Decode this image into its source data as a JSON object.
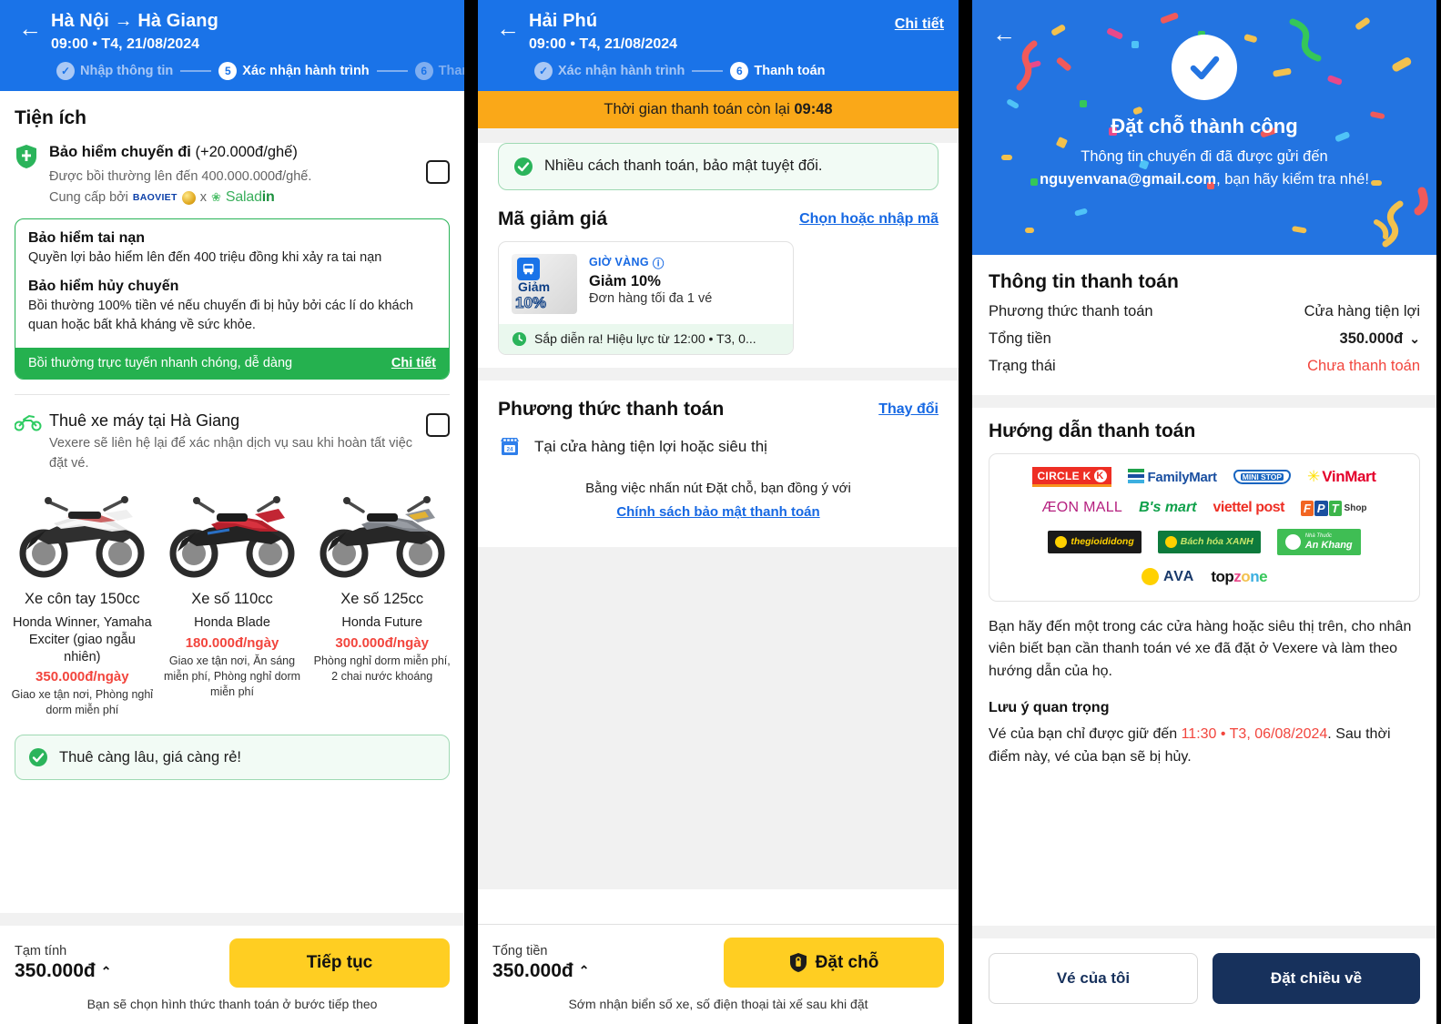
{
  "panel1": {
    "header": {
      "title": "Hà Nội → Hà Giang",
      "subtitle": "09:00 • T4, 21/08/2024",
      "steps": [
        {
          "label": "Nhập thông tin",
          "marker": "✓",
          "state": "done"
        },
        {
          "label": "Xác nhận hành trình",
          "marker": "5",
          "state": "active"
        },
        {
          "label": "Thanh toán",
          "marker": "6",
          "state": "future"
        }
      ]
    },
    "section_title": "Tiện ích",
    "insurance": {
      "title_bold": "Bảo hiểm chuyến đi",
      "title_rest": " (+20.000đ/ghế)",
      "desc": "Được bồi thường lên đến 400.000.000đ/ghế.",
      "provided_by": "Cung cấp bởi",
      "provider_1": "BAOVIET",
      "provider_x": "x",
      "provider_2a": "Salad",
      "provider_2b": "in",
      "card": {
        "b1_title": "Bảo hiểm tai nạn",
        "b1_desc": "Quyền lợi bảo hiểm lên đến 400 triệu đồng khi xảy ra tai nạn",
        "b2_title": "Bảo hiểm hủy chuyến",
        "b2_desc": "Bồi thường 100% tiền vé nếu chuyến đi bị hủy bởi các lí do khách quan hoặc bất khả kháng về sức khỏe.",
        "foot_text": "Bồi thường trực tuyến nhanh chóng, dễ dàng",
        "foot_link": "Chi tiết"
      }
    },
    "bike_rental": {
      "title": "Thuê xe máy tại Hà Giang",
      "desc": "Vexere sẽ liên hệ lại để xác nhận dịch vụ sau khi hoàn tất việc đặt vé.",
      "bikes": [
        {
          "name": "Xe côn tay 150cc",
          "model": "Honda Winner, Yamaha Exciter (giao ngẫu nhiên)",
          "price": "350.000đ/ngày",
          "perks": "Giao xe tận nơi, Phòng nghỉ dorm miễn phí",
          "color": "#E8E8E8",
          "accent": "#C23A3A"
        },
        {
          "name": "Xe số 110cc",
          "model": "Honda Blade",
          "price": "180.000đ/ngày",
          "perks": "Giao xe tận nơi, Ăn sáng miễn phí, Phòng nghỉ dorm miễn phí",
          "color": "#B5202C",
          "accent": "#2A6FC4"
        },
        {
          "name": "Xe số 125cc",
          "model": "Honda Future",
          "price": "300.000đ/ngày",
          "perks": "Phòng nghỉ dorm miễn phí, 2 chai nước khoáng",
          "color": "#7C8087",
          "accent": "#E2B233"
        }
      ]
    },
    "promo_banner": "Thuê càng lâu, giá càng rẻ!",
    "bottom": {
      "total_label": "Tạm tính",
      "total_value": "350.000đ",
      "caret": "⌃",
      "button": "Tiếp tục",
      "note": "Bạn sẽ chọn hình thức thanh toán ở bước tiếp theo"
    }
  },
  "panel2": {
    "header": {
      "title": "Hải Phú",
      "subtitle": "09:00 • T4, 21/08/2024",
      "detail_link": "Chi tiết",
      "steps": [
        {
          "label": "Xác nhận hành trình",
          "marker": "✓",
          "state": "done"
        },
        {
          "label": "Thanh toán",
          "marker": "6",
          "state": "active"
        }
      ]
    },
    "timer_prefix": "Thời gian thanh toán còn lại ",
    "timer_value": "09:48",
    "secure_note": "Nhiều cách thanh toán, bảo mật tuyệt đối.",
    "discount": {
      "title": "Mã giảm giá",
      "link": "Chọn hoặc nhập mã",
      "voucher": {
        "thumb_label": "Giảm",
        "thumb_pct": "10%",
        "tag": "GIỜ VÀNG",
        "info_icon": "ⓘ",
        "title": "Giảm 10%",
        "sub": "Đơn hàng tối đa 1 vé",
        "foot": "Sắp diễn ra! Hiệu lực từ 12:00 • T3, 0..."
      }
    },
    "payment_method": {
      "title": "Phương thức thanh toán",
      "link": "Thay đổi",
      "selected": "Tại cửa hàng tiện lợi hoặc siêu thị",
      "agree_text": "Bằng việc nhấn nút Đặt chỗ, bạn đồng ý với",
      "agree_link": "Chính sách bảo mật thanh toán"
    },
    "bottom": {
      "total_label": "Tổng tiền",
      "total_value": "350.000đ",
      "caret": "⌃",
      "button": "Đặt chỗ",
      "note": "Sớm nhận biển số xe, số điện thoại tài xế sau khi đặt"
    }
  },
  "panel3": {
    "success": {
      "title": "Đặt chỗ thành công",
      "line1": "Thông tin chuyến đi đã được gửi đến",
      "email": "nguyenvana@gmail.com",
      "line2": ", bạn hãy kiểm tra nhé!"
    },
    "payment_info": {
      "title": "Thông tin thanh toán",
      "rows": [
        {
          "key": "Phương thức thanh toán",
          "value": "Cửa hàng tiện lợi",
          "style": "plain"
        },
        {
          "key": "Tổng tiền",
          "value": "350.000đ",
          "caret": "⌄",
          "style": "bold"
        },
        {
          "key": "Trạng thái",
          "value": "Chưa thanh toán",
          "style": "red"
        }
      ]
    },
    "guide": {
      "title": "Hướng dẫn thanh toán",
      "logos_row1": [
        "CIRCLE K",
        "FamilyMart",
        "MINI STOP",
        "VinMart"
      ],
      "logos_row2": [
        "ÆON MALL",
        "B's mart",
        "viettel post",
        "FPT Shop"
      ],
      "logos_row3": [
        "thegioididong",
        "Bách hóa XANH",
        "An Khang"
      ],
      "logos_row4": [
        "AVA",
        "topzone"
      ],
      "paragraph": "Bạn hãy đến một trong các cửa hàng hoặc siêu thị trên, cho nhân viên biết bạn cần thanh toán vé xe đã đặt ở Vexere và làm theo hướng dẫn của họ.",
      "note_title": "Lưu ý quan trọng",
      "note_a": "Vé của bạn chỉ được giữ đến ",
      "note_red": "11:30 • T3, 06/08/2024",
      "note_b": ". Sau thời điểm này, vé của bạn sẽ bị hủy."
    },
    "bottom": {
      "secondary": "Vé của tôi",
      "primary": "Đặt chiều về"
    }
  },
  "colors": {
    "brand_blue": "#1A73E8",
    "accent_yellow": "#FFCE22",
    "green": "#25B14F",
    "red": "#F2453D",
    "orange": "#FAA818",
    "navy": "#17315C"
  }
}
